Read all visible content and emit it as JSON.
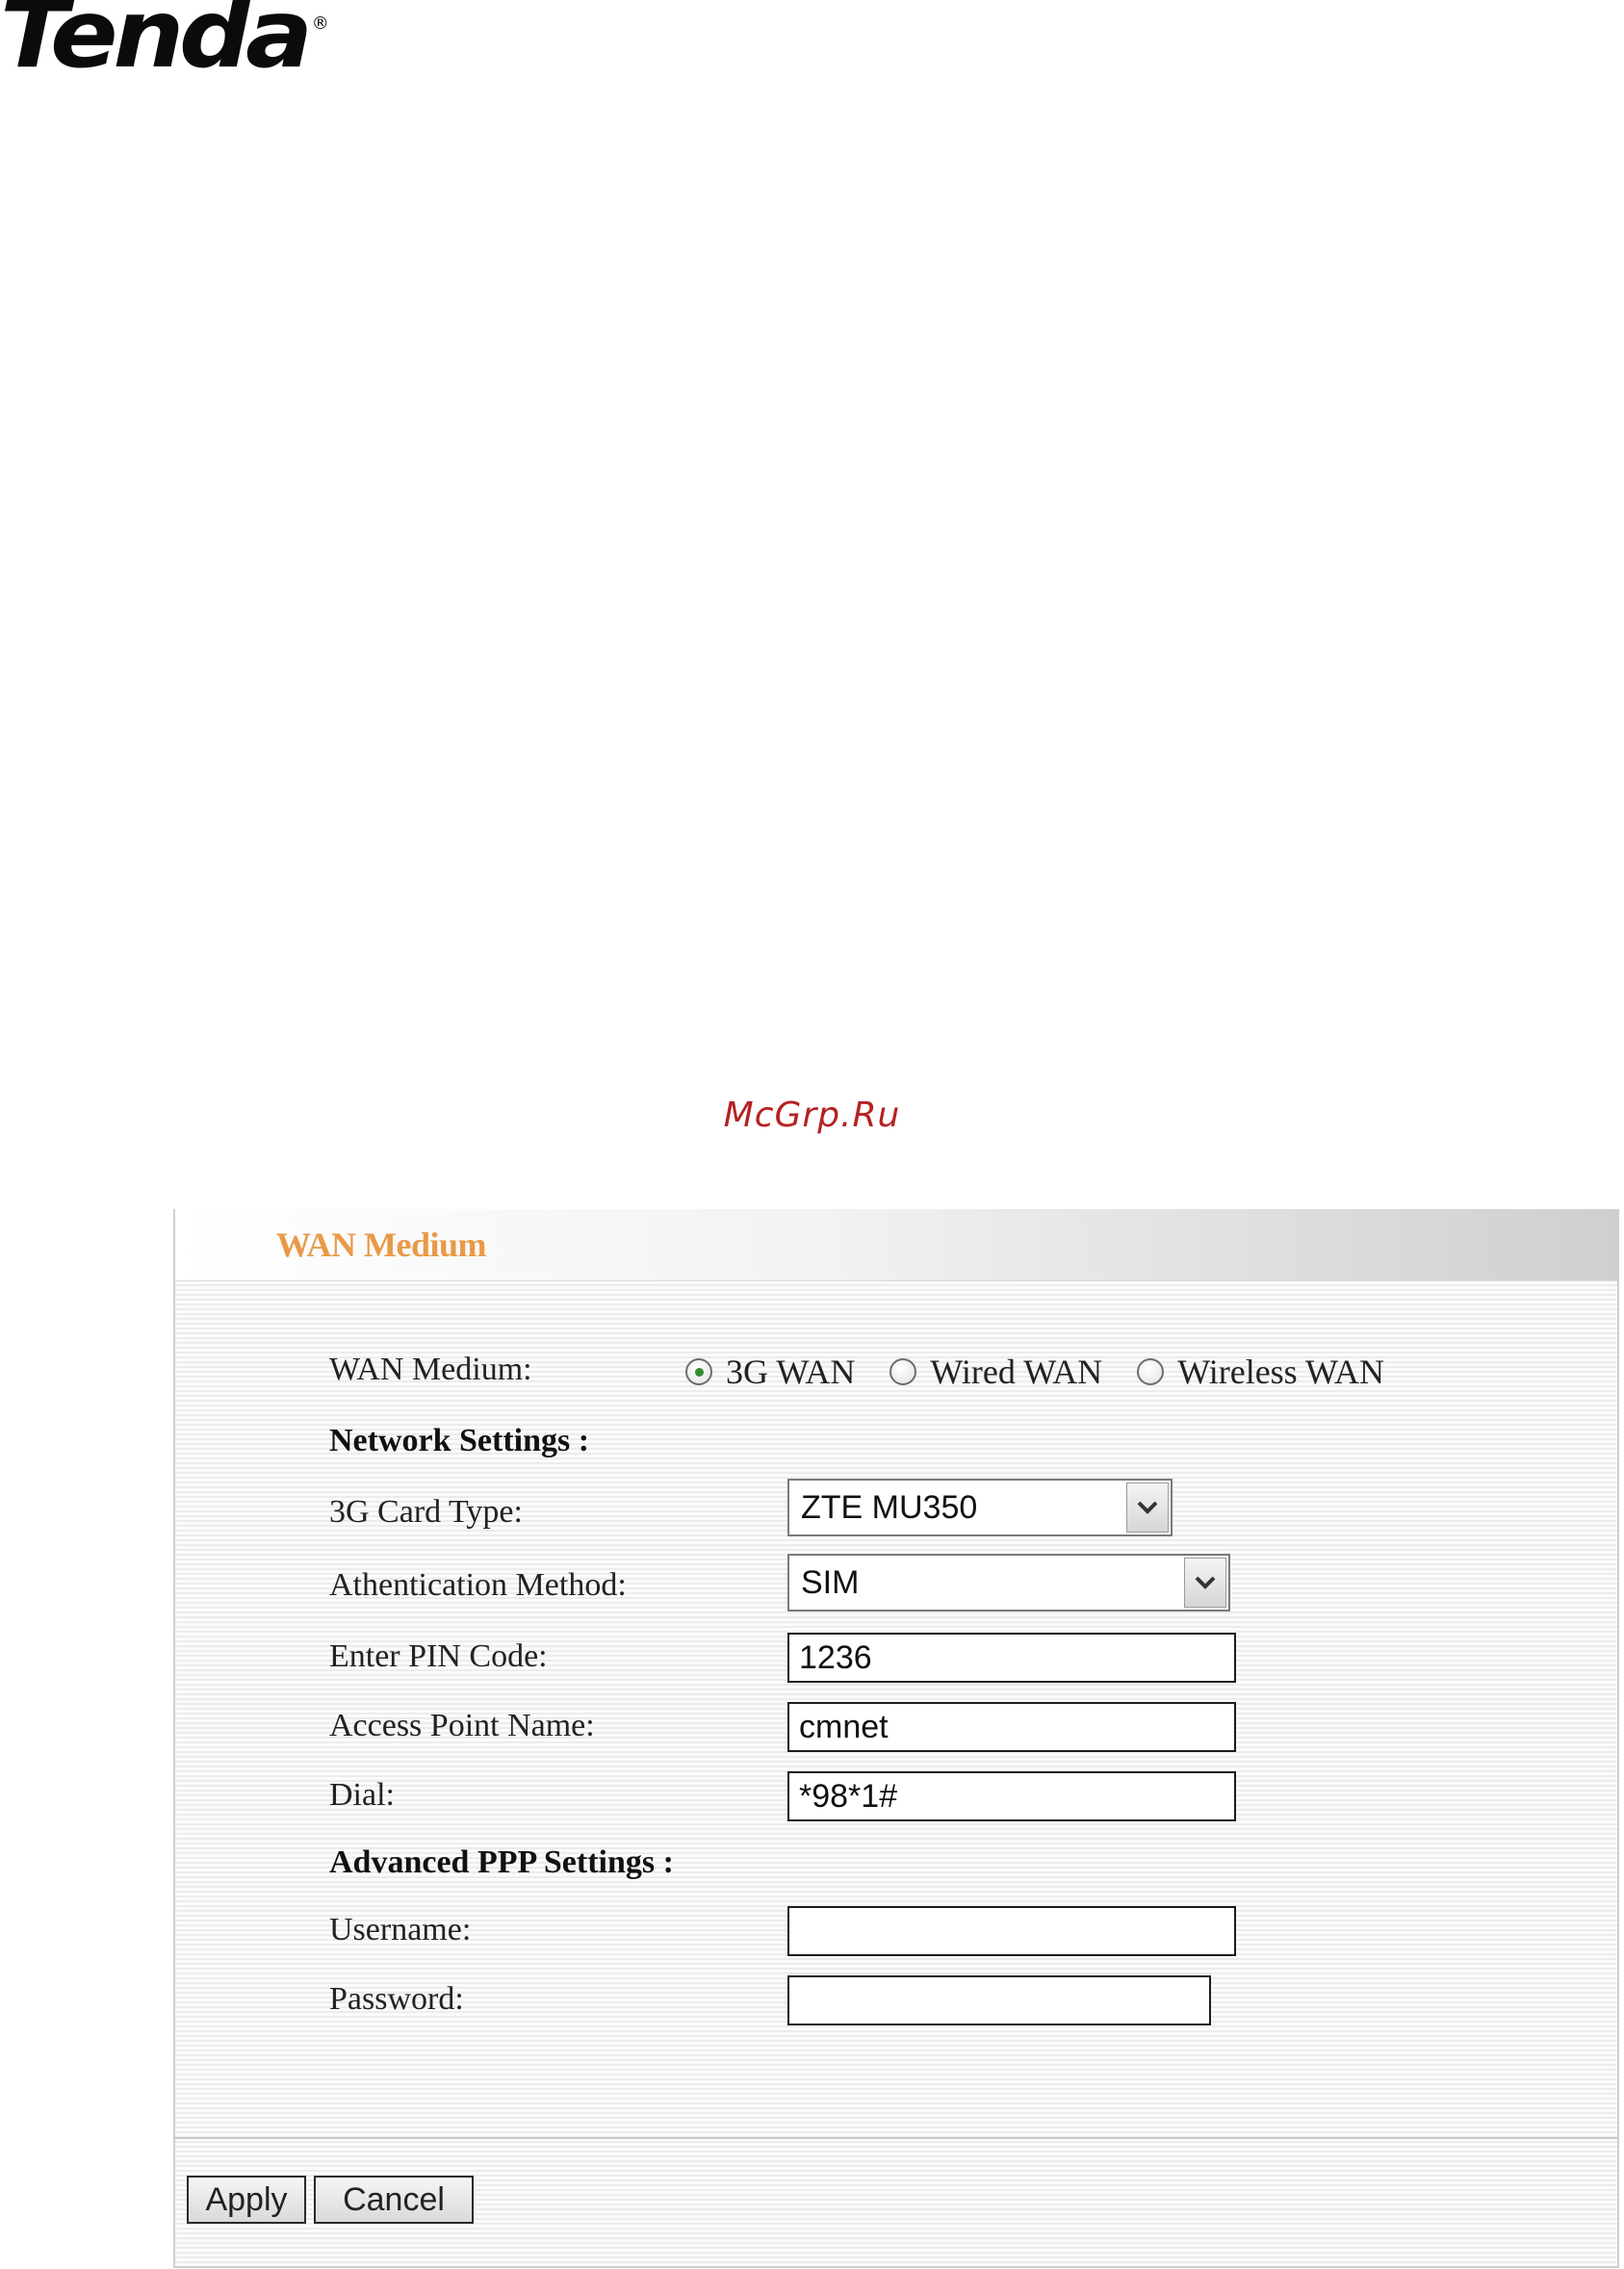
{
  "brand": {
    "logo_text": "Tenda",
    "registered_mark": "®"
  },
  "watermark": "McGrp.Ru",
  "panel": {
    "title": "WAN Medium",
    "wan_medium": {
      "label": "WAN Medium:",
      "options": [
        "3G WAN",
        "Wired WAN",
        "Wireless WAN"
      ],
      "selected": "3G WAN"
    },
    "network_settings": {
      "heading": "Network Settings :",
      "card_type": {
        "label": "3G Card Type:",
        "value": "ZTE MU350"
      },
      "auth_method": {
        "label": "Athentication Method:",
        "value": "SIM"
      },
      "pin_code": {
        "label": "Enter PIN Code:",
        "value": "1236"
      },
      "apn": {
        "label": "Access Point Name:",
        "value": "cmnet"
      },
      "dial": {
        "label": "Dial:",
        "value": "*98*1#"
      }
    },
    "advanced_ppp": {
      "heading": "Advanced PPP Settings :",
      "username": {
        "label": "Username:",
        "value": ""
      },
      "password": {
        "label": "Password:",
        "value": ""
      }
    },
    "buttons": {
      "apply": "Apply",
      "cancel": "Cancel"
    }
  }
}
